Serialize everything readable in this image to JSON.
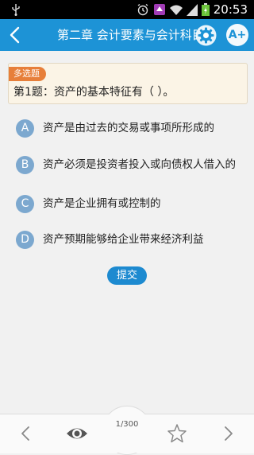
{
  "status_bar": {
    "time": "20:53"
  },
  "header": {
    "title": "第二章 会计要素与会计科目",
    "font_button_label": "A+"
  },
  "question": {
    "type_badge": "多选题",
    "text": "第1题：资产的基本特征有（ ）。"
  },
  "options": [
    {
      "letter": "A",
      "text": "资产是由过去的交易或事项所形成的"
    },
    {
      "letter": "B",
      "text": "资产必须是投资者投入或向债权人借入的"
    },
    {
      "letter": "C",
      "text": "资产是企业拥有或控制的"
    },
    {
      "letter": "D",
      "text": "资产预期能够给企业带来经济利益"
    }
  ],
  "submit_label": "提交",
  "footer": {
    "page_indicator": "1/300"
  },
  "colors": {
    "accent": "#1d93d6",
    "option_circle": "#7ca8cf",
    "badge": "#e77f3a"
  }
}
